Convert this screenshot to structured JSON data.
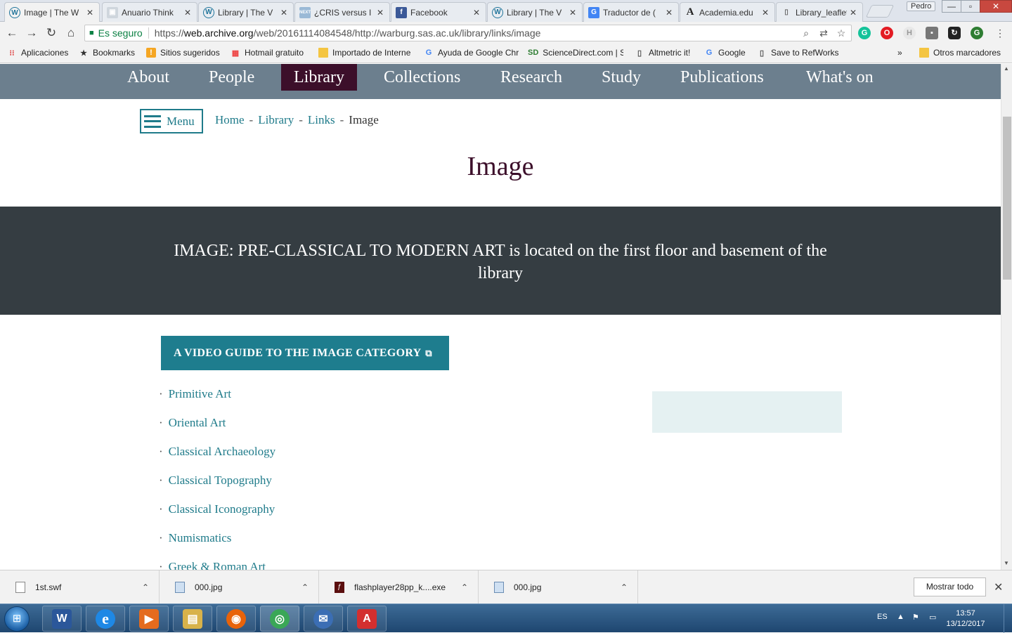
{
  "browser": {
    "tabs": [
      {
        "title": "Image | The W",
        "icon": "W",
        "active": true
      },
      {
        "title": "Anuario Think",
        "icon": "img"
      },
      {
        "title": "Library | The V",
        "icon": "W"
      },
      {
        "title": "¿CRIS versus I",
        "icon": "NEXT"
      },
      {
        "title": "Facebook",
        "icon": "f"
      },
      {
        "title": "Library | The V",
        "icon": "W"
      },
      {
        "title": "Traductor de (",
        "icon": "G"
      },
      {
        "title": "Academia.edu",
        "icon": "A"
      },
      {
        "title": "Library_leaflet",
        "icon": "doc"
      }
    ],
    "profile_name": "Pedro",
    "window_controls": {
      "minimize": "—",
      "maximize": "▫",
      "close": "✕"
    },
    "nav": {
      "back": "←",
      "forward": "→",
      "reload": "↻",
      "home": "⌂"
    },
    "omnibox": {
      "secure_label": "Es seguro",
      "url_scheme": "https://",
      "url_host": "web.archive.org",
      "url_path": "/web/20161114084548/http://warburg.sas.ac.uk/library/links/image"
    },
    "bookmarks": [
      {
        "label": "Aplicaciones",
        "icon": "apps-icon"
      },
      {
        "label": "Bookmarks",
        "icon": "star-icon"
      },
      {
        "label": "Sitios sugeridos",
        "icon": "ie-icon"
      },
      {
        "label": "Hotmail gratuito",
        "icon": "msn-icon"
      },
      {
        "label": "Importado de Interne",
        "icon": "folder-icon"
      },
      {
        "label": "Ayuda de Google Chr",
        "icon": "google-icon"
      },
      {
        "label": "ScienceDirect.com | S",
        "icon": "sd-icon"
      },
      {
        "label": "Altmetric it!",
        "icon": "page-icon"
      },
      {
        "label": "Google",
        "icon": "google-icon"
      },
      {
        "label": "Save to RefWorks",
        "icon": "page-icon"
      }
    ],
    "bookmarks_overflow": "»",
    "other_bookmarks": "Otros marcadores"
  },
  "site": {
    "nav": [
      "About",
      "People",
      "Library",
      "Collections",
      "Research",
      "Study",
      "Publications",
      "What's on"
    ],
    "active_nav": "Library",
    "menu_label": "Menu",
    "breadcrumb": {
      "home": "Home",
      "library": "Library",
      "links": "Links",
      "current": "Image",
      "separator": "-"
    },
    "page_title": "Image",
    "banner_text": "IMAGE: PRE-CLASSICAL TO MODERN ART is located on the first floor and basement of the library",
    "video_button_label": "A VIDEO GUIDE TO THE IMAGE CATEGORY",
    "categories": [
      "Primitive Art",
      "Oriental Art",
      "Classical Archaeology",
      "Classical Topography",
      "Classical Iconography",
      "Numismatics",
      "Greek & Roman Art"
    ],
    "bullet": "·"
  },
  "downloads": {
    "items": [
      {
        "name": "1st.swf",
        "icon": "file"
      },
      {
        "name": "000.jpg",
        "icon": "image"
      },
      {
        "name": "flashplayer28pp_k....exe",
        "icon": "flash"
      },
      {
        "name": "000.jpg",
        "icon": "image"
      }
    ],
    "chevron": "⌃",
    "show_all_label": "Mostrar todo",
    "close": "✕"
  },
  "taskbar": {
    "start": "⊞",
    "apps": [
      {
        "name": "word",
        "glyph": "W",
        "color": "#2b579a"
      },
      {
        "name": "internet-explorer",
        "glyph": "e",
        "color": "#1e88e5"
      },
      {
        "name": "media-player",
        "glyph": "▶",
        "color": "#e46b1e"
      },
      {
        "name": "file-explorer",
        "glyph": "▤",
        "color": "#d8b24a"
      },
      {
        "name": "firefox",
        "glyph": "◉",
        "color": "#e8630a"
      },
      {
        "name": "chrome",
        "glyph": "◎",
        "color": "#3aa757"
      },
      {
        "name": "thunderbird",
        "glyph": "✉",
        "color": "#3b6eb4"
      },
      {
        "name": "acrobat",
        "glyph": "A",
        "color": "#d32f2f"
      }
    ],
    "language": "ES",
    "tray_up": "▲",
    "time": "13:57",
    "date": "13/12/2017"
  },
  "colors": {
    "site_nav": "#6c7f8e",
    "site_nav_active": "#3c0f2a",
    "accent_teal": "#1f7b8a",
    "banner": "#353d42",
    "aside_box": "#e5f1f2"
  }
}
